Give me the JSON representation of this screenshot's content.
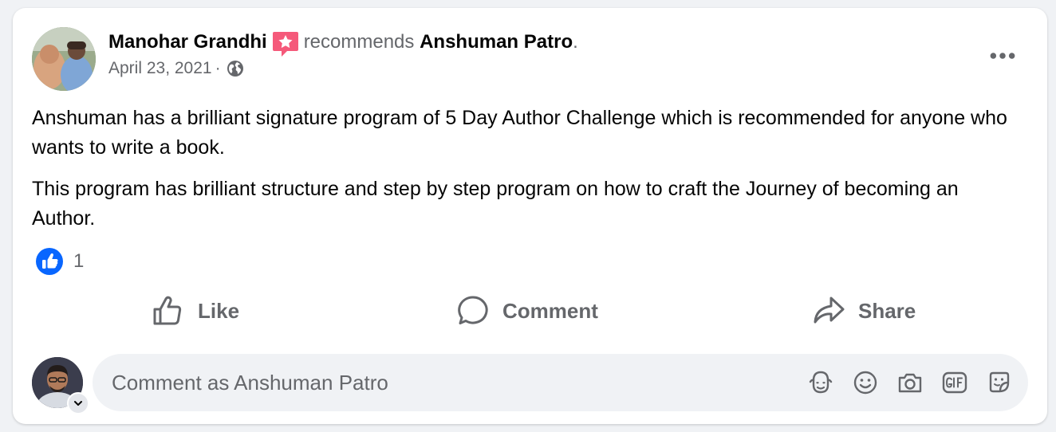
{
  "post": {
    "author": "Manohar Grandhi",
    "recommends_text": "recommends",
    "recommended_page": "Anshuman Patro",
    "period": ".",
    "date": "April 23, 2021",
    "separator": "·",
    "audience_icon": "globe-icon",
    "more_icon": "more-horizontal-icon",
    "paragraphs": [
      "Anshuman has a brilliant signature program of 5 Day Author Challenge which is recommended for anyone who wants to write a book.",
      "This program has brilliant structure and step by step program on how to craft the Journey of becoming an Author."
    ]
  },
  "reactions": {
    "icon": "like-reaction-icon",
    "count": "1"
  },
  "actions": {
    "like": "Like",
    "comment": "Comment",
    "share": "Share"
  },
  "composer": {
    "placeholder": "Comment as Anshuman Patro",
    "tools": [
      "avatar-sticker-icon",
      "emoji-icon",
      "camera-icon",
      "gif-icon",
      "sticker-icon"
    ]
  },
  "colors": {
    "brand_blue": "#0866ff",
    "recommend_badge": "#f5597a",
    "muted": "#65676b",
    "input_bg": "#f0f2f5"
  }
}
